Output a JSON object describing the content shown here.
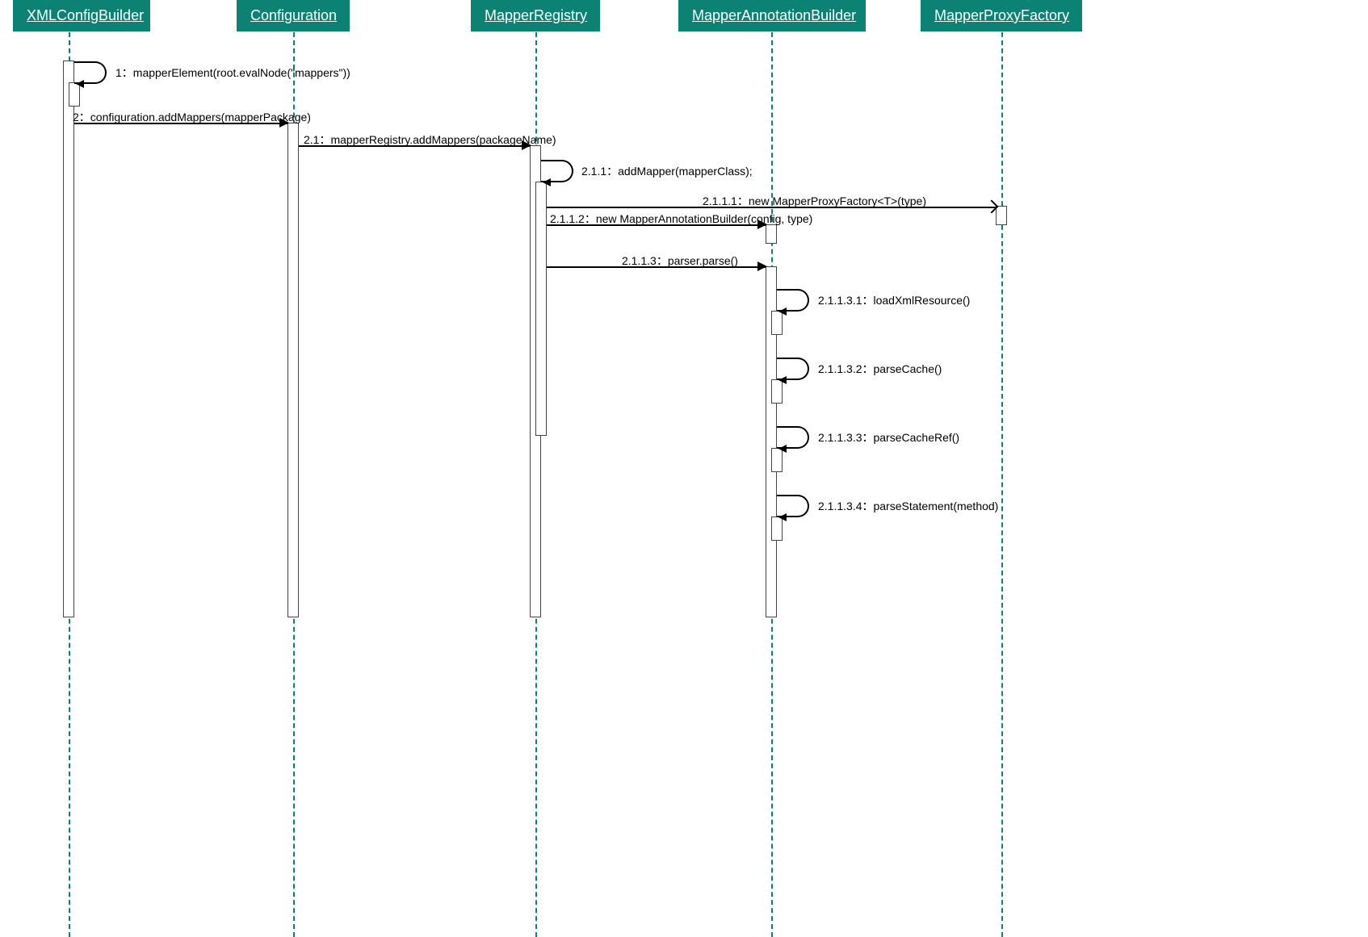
{
  "participants": {
    "p1": "XMLConfigBuilder",
    "p2": "Configuration",
    "p3": "MapperRegistry",
    "p4": "MapperAnnotationBuilder",
    "p5": "MapperProxyFactory"
  },
  "messages": {
    "m1": "1：mapperElement(root.evalNode(\"mappers\"))",
    "m2": "2：configuration.addMappers(mapperPackage)",
    "m2_1": "2.1：mapperRegistry.addMappers(packageName)",
    "m2_1_1": "2.1.1：addMapper(mapperClass);",
    "m2_1_1_1": "2.1.1.1：new MapperProxyFactory<T>(type)",
    "m2_1_1_2": "2.1.1.2：new MapperAnnotationBuilder(config, type)",
    "m2_1_1_3": "2.1.1.3：parser.parse()",
    "m2_1_1_3_1": "2.1.1.3.1：loadXmlResource()",
    "m2_1_1_3_2": "2.1.1.3.2：parseCache()",
    "m2_1_1_3_3": "2.1.1.3.3：parseCacheRef()",
    "m2_1_1_3_4": "2.1.1.3.4：parseStatement(method)"
  },
  "colors": {
    "participant_bg": "#0b8274",
    "participant_fg": "#ffffff",
    "lifeline": "#0b8274"
  }
}
